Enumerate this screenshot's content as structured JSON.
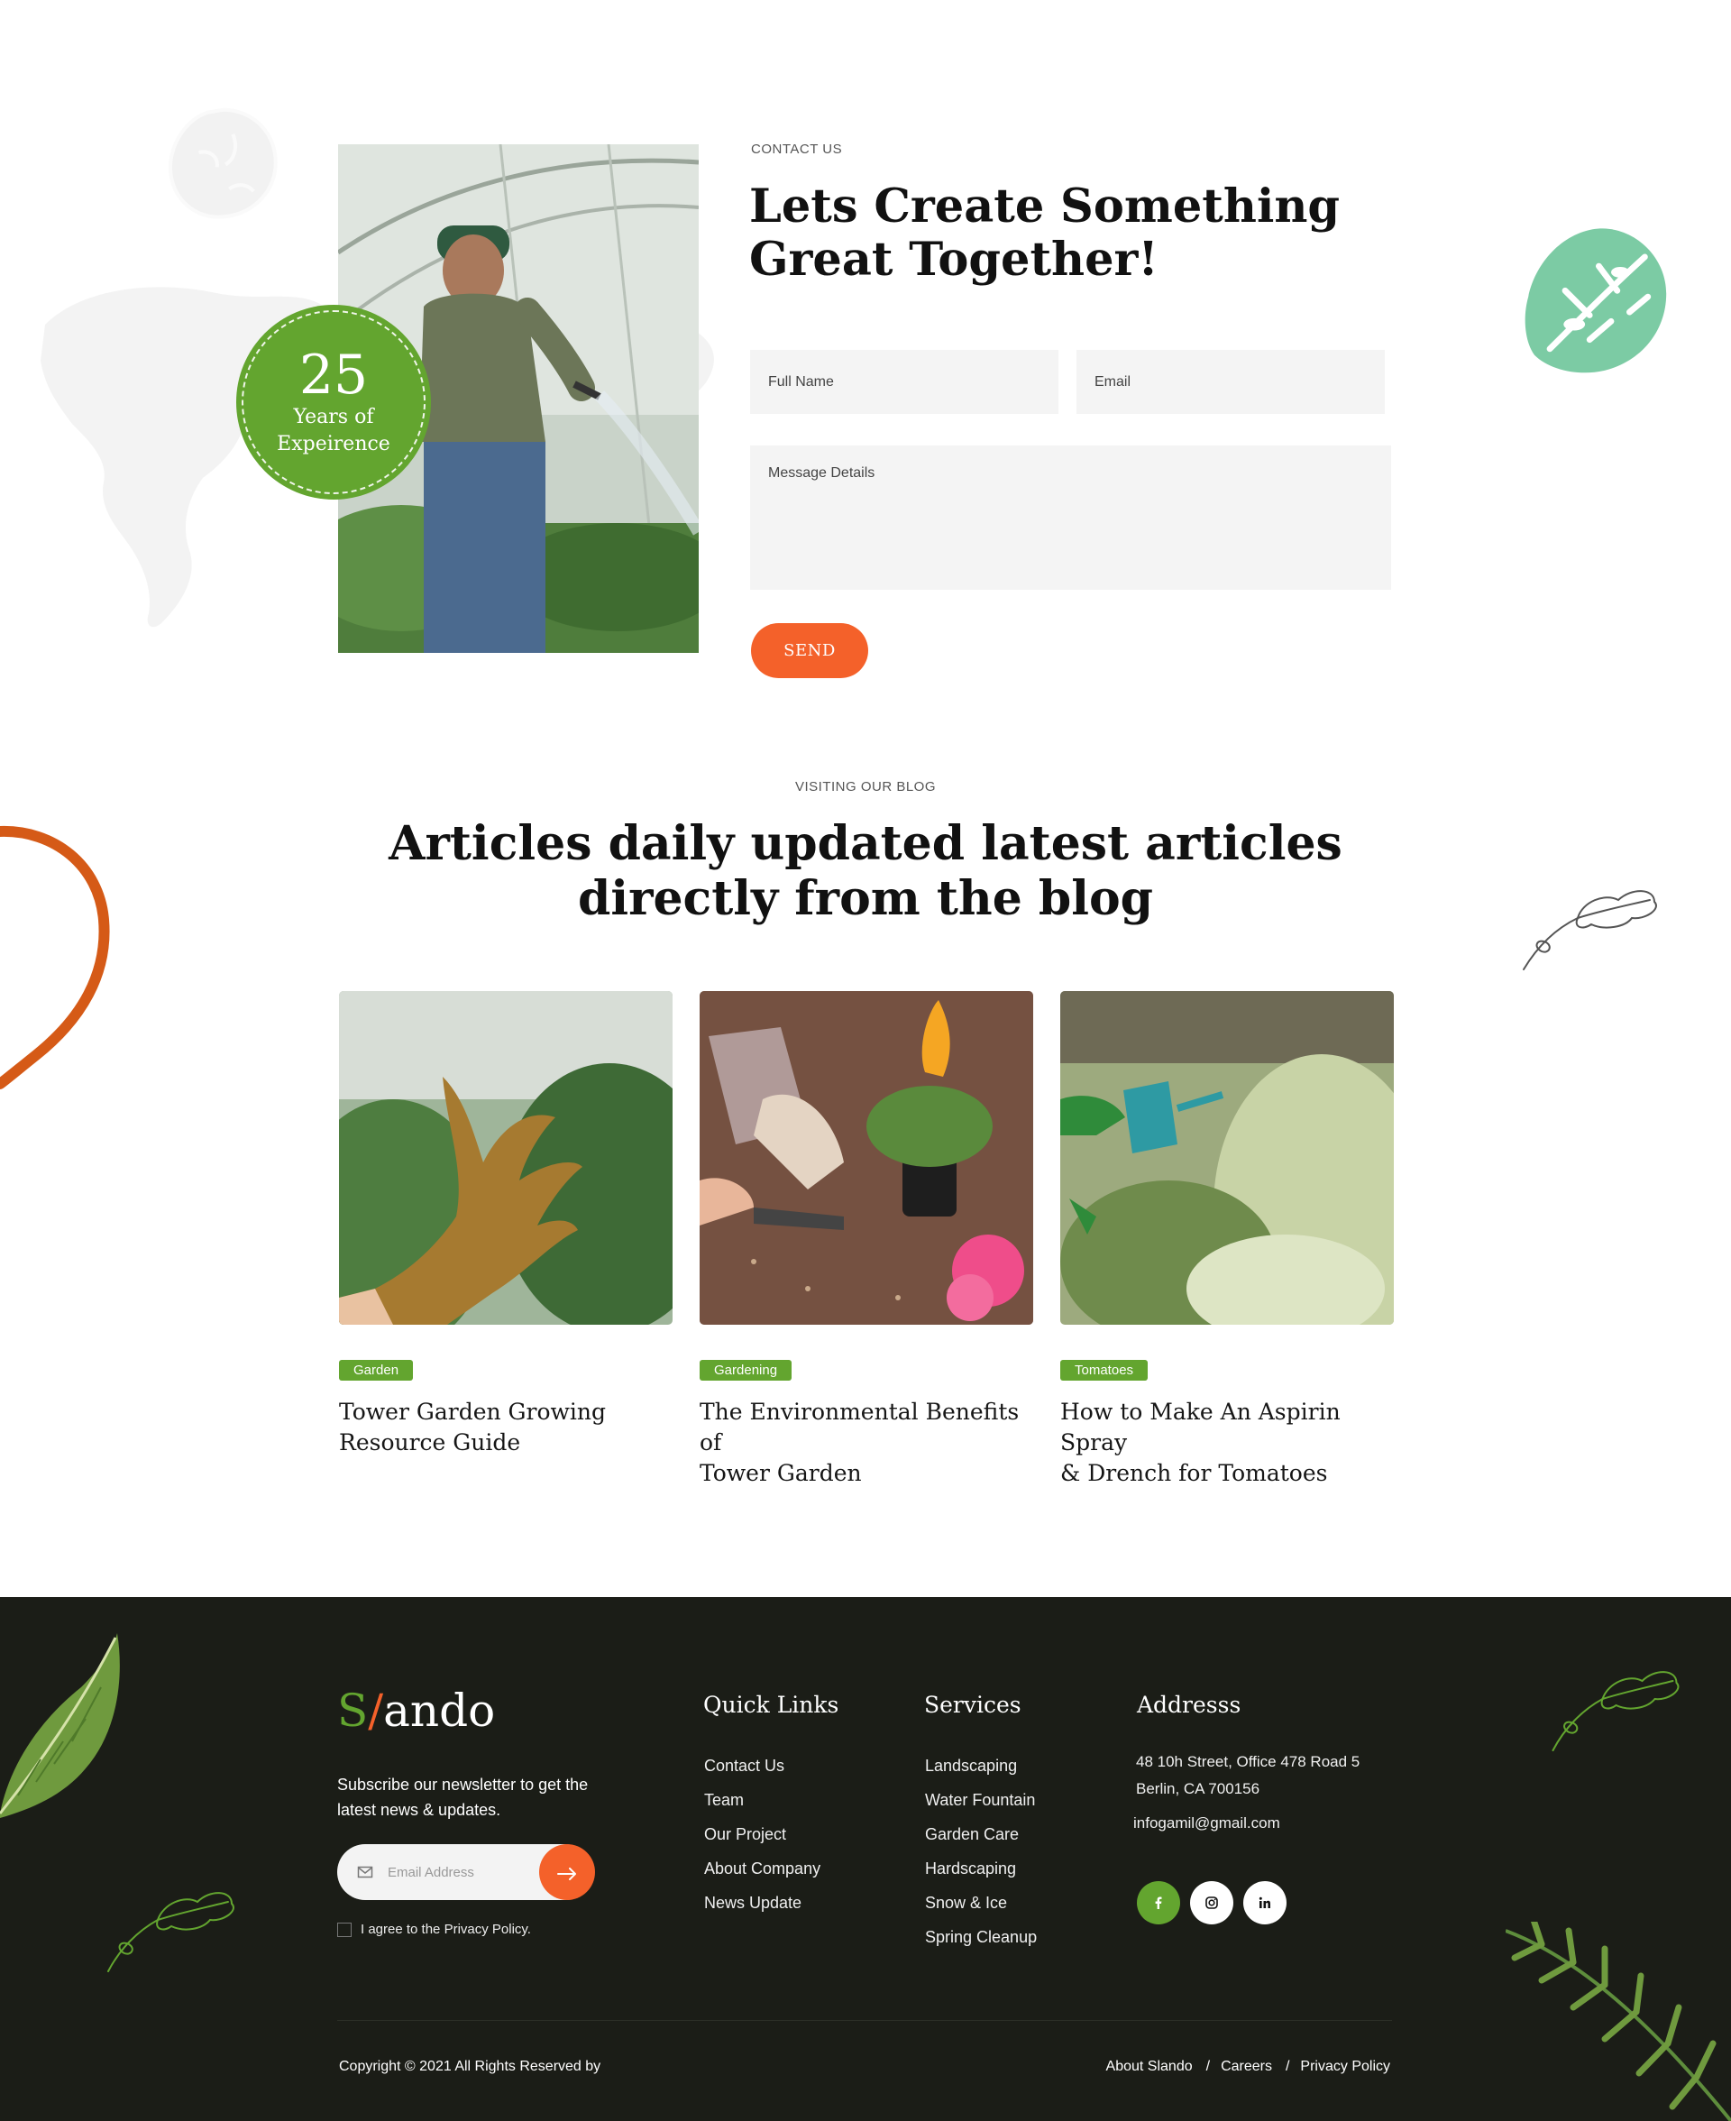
{
  "contact": {
    "eyebrow": "CONTACT US",
    "title_line1": "Lets Create Something",
    "title_line2": "Great Together!",
    "badge_number": "25",
    "badge_line1": "Years of",
    "badge_line2": "Expeirence",
    "form": {
      "name_placeholder": "Full Name",
      "email_placeholder": "Email",
      "message_placeholder": "Message Details",
      "send_label": "SEND"
    }
  },
  "blog": {
    "eyebrow": "VISITING OUR BLOG",
    "title_line1": "Articles daily updated latest articles",
    "title_line2": "directly from the blog",
    "posts": [
      {
        "tag": "Garden",
        "title_line1": "Tower Garden Growing",
        "title_line2": "Resource Guide"
      },
      {
        "tag": "Gardening",
        "title_line1": "The Environmental Benefits of",
        "title_line2": "Tower Garden"
      },
      {
        "tag": "Tomatoes",
        "title_line1": "How to Make An Aspirin Spray",
        "title_line2": "& Drench for Tomatoes"
      }
    ]
  },
  "footer": {
    "logo": {
      "s": "S",
      "slash": "/",
      "rest": "ando"
    },
    "newsletter_line1": "Subscribe our newsletter to get the",
    "newsletter_line2": "latest news & updates.",
    "email_placeholder": "Email Address",
    "submit_icon": "arrow-right-icon",
    "agree_text": "I agree to the Privacy Policy.",
    "quick_links": {
      "title": "Quick Links",
      "items": [
        "Contact Us",
        "Team",
        "Our Project",
        "About Company",
        "News Update"
      ]
    },
    "services": {
      "title": "Services",
      "items": [
        "Landscaping",
        "Water Fountain",
        "Garden Care",
        "Hardscaping",
        "Snow & Ice",
        "Spring Cleanup"
      ]
    },
    "address": {
      "title": "Addresss",
      "line1": "48 10h Street, Office 478 Road 5",
      "line2": "Berlin, CA 700156",
      "email": "infogamil@gmail.com"
    },
    "social": [
      "facebook-icon",
      "instagram-icon",
      "linkedin-icon"
    ],
    "copyright": "Copyright © 2021 All Rights Reserved by",
    "legal": [
      "About Slando",
      "Careers",
      "Privacy Policy"
    ],
    "legal_sep": "/"
  },
  "colors": {
    "brand_green": "#63a52f",
    "brand_orange": "#f4612a",
    "footer_bg": "#1b1d17",
    "mint_leaf": "#7ccba4"
  }
}
